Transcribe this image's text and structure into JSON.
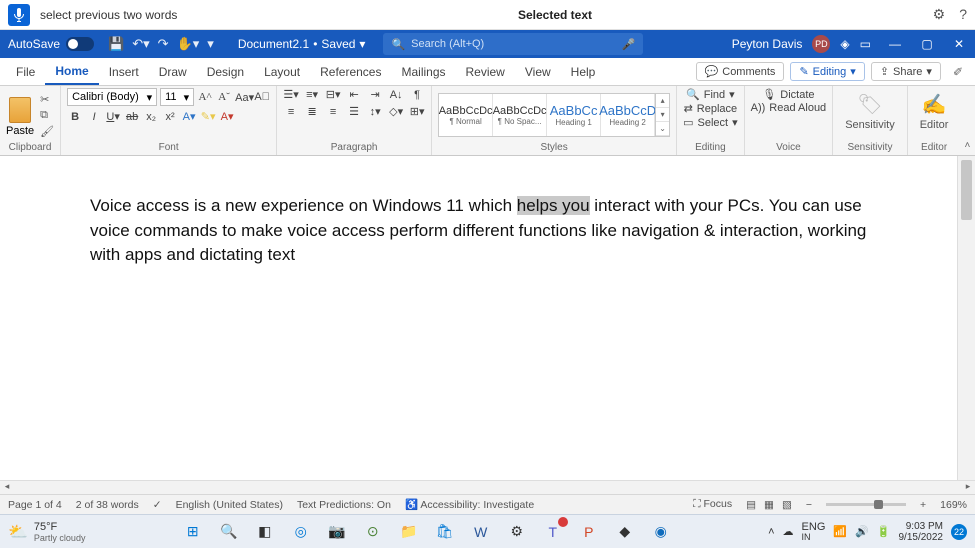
{
  "voice": {
    "command": "select previous two words",
    "center": "Selected text"
  },
  "titlebar": {
    "autosave_label": "AutoSave",
    "doc_name": "Document2.1",
    "doc_state": "Saved",
    "search_placeholder": "Search (Alt+Q)",
    "user_name": "Peyton Davis",
    "user_initials": "PD"
  },
  "tabs": [
    "File",
    "Home",
    "Insert",
    "Draw",
    "Design",
    "Layout",
    "References",
    "Mailings",
    "Review",
    "View",
    "Help"
  ],
  "active_tab": "Home",
  "ribbon_right": {
    "comments": "Comments",
    "editing": "Editing",
    "share": "Share"
  },
  "ribbon": {
    "clipboard": {
      "paste": "Paste",
      "label": "Clipboard"
    },
    "font": {
      "name": "Calibri (Body)",
      "size": "11",
      "label": "Font"
    },
    "paragraph": {
      "label": "Paragraph"
    },
    "styles": {
      "items": [
        {
          "preview": "AaBbCcDc",
          "name": "¶ Normal"
        },
        {
          "preview": "AaBbCcDc",
          "name": "¶ No Spac..."
        },
        {
          "preview": "AaBbCc",
          "name": "Heading 1"
        },
        {
          "preview": "AaBbCcD",
          "name": "Heading 2"
        }
      ],
      "label": "Styles"
    },
    "editing": {
      "find": "Find",
      "replace": "Replace",
      "select": "Select",
      "label": "Editing"
    },
    "voice": {
      "dictate": "Dictate",
      "readaloud": "Read Aloud",
      "label": "Voice"
    },
    "sensitivity": {
      "btn": "Sensitivity",
      "label": "Sensitivity"
    },
    "editor": {
      "btn": "Editor",
      "label": "Editor"
    }
  },
  "document": {
    "pre": "Voice access is a new experience on Windows 11 which ",
    "selected": "helps you",
    "post": " interact with your PCs. You can use voice commands to make voice access perform different functions like navigation & interaction, working with apps and dictating text"
  },
  "status": {
    "page": "Page 1 of 4",
    "words": "2 of 38 words",
    "lang": "English (United States)",
    "predictions": "Text Predictions: On",
    "accessibility": "Accessibility: Investigate",
    "focus": "Focus",
    "zoom": "169%"
  },
  "taskbar": {
    "temp": "75°F",
    "weather": "Partly cloudy",
    "lang1": "ENG",
    "lang2": "IN",
    "time": "9:03 PM",
    "date": "9/15/2022",
    "notif": "22"
  }
}
